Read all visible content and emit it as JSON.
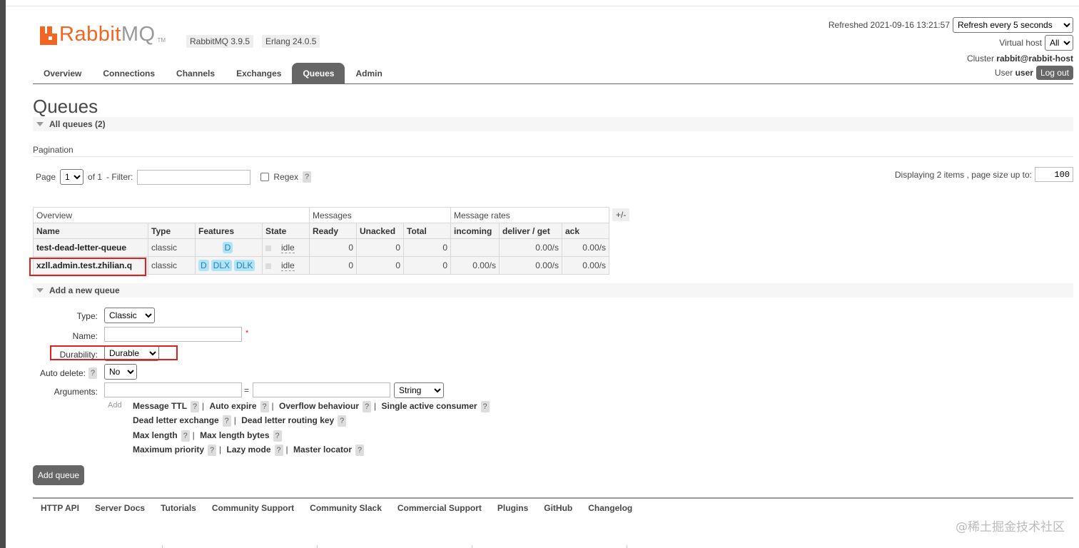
{
  "header": {
    "logo_rabbit": "Rabbit",
    "logo_mq": "MQ",
    "logo_tm": "TM",
    "version_rabbit": "RabbitMQ 3.9.5",
    "version_erlang": "Erlang 24.0.5",
    "refreshed": "Refreshed 2021-09-16 13:21:57",
    "refresh_select": "Refresh every 5 seconds",
    "vhost_label": "Virtual host",
    "vhost_value": "All",
    "cluster_label": "Cluster",
    "cluster_value": "rabbit@rabbit-host",
    "user_label": "User",
    "user_value": "user",
    "logout": "Log out"
  },
  "nav": {
    "tabs": [
      "Overview",
      "Connections",
      "Channels",
      "Exchanges",
      "Queues",
      "Admin"
    ],
    "active": "Queues"
  },
  "page": {
    "title": "Queues",
    "all_queues": "All queues (2)"
  },
  "pagination": {
    "title": "Pagination",
    "page_label": "Page",
    "page_value": "1",
    "of_label": "of 1",
    "filter_label": "- Filter:",
    "filter_value": "",
    "regex_label": "Regex",
    "help": "?",
    "displaying": "Displaying 2 items , page size up to:",
    "page_size": "100"
  },
  "table": {
    "groups": [
      "Overview",
      "Messages",
      "Message rates"
    ],
    "columns": [
      "Name",
      "Type",
      "Features",
      "State",
      "Ready",
      "Unacked",
      "Total",
      "incoming",
      "deliver / get",
      "ack"
    ],
    "plusminus": "+/-",
    "rows": [
      {
        "name": "test-dead-letter-queue",
        "type": "classic",
        "features": [
          "D"
        ],
        "state": "idle",
        "ready": "0",
        "unacked": "0",
        "total": "0",
        "incoming": "",
        "deliver_get": "0.00/s",
        "ack": "0.00/s"
      },
      {
        "name": "xzll.admin.test.zhilian.q",
        "type": "classic",
        "features": [
          "D",
          "DLX",
          "DLK"
        ],
        "state": "idle",
        "ready": "0",
        "unacked": "0",
        "total": "0",
        "incoming": "0.00/s",
        "deliver_get": "0.00/s",
        "ack": "0.00/s"
      }
    ]
  },
  "add_queue": {
    "section": "Add a new queue",
    "type_label": "Type:",
    "type_value": "Classic",
    "name_label": "Name:",
    "name_value": "",
    "required": "*",
    "durability_label": "Durability:",
    "durability_value": "Durable",
    "auto_delete_label": "Auto delete:",
    "auto_delete_help": "?",
    "auto_delete_value": "No",
    "arguments_label": "Arguments:",
    "arg_eq": "=",
    "arg_type": "String",
    "add_label": "Add",
    "arg_rows": [
      [
        "Message TTL",
        "Auto expire",
        "Overflow behaviour",
        "Single active consumer"
      ],
      [
        "Dead letter exchange",
        "Dead letter routing key"
      ],
      [
        "Max length",
        "Max length bytes"
      ],
      [
        "Maximum priority",
        "Lazy mode",
        "Master locator"
      ]
    ],
    "submit": "Add queue"
  },
  "footer": {
    "links": [
      "HTTP API",
      "Server Docs",
      "Tutorials",
      "Community Support",
      "Community Slack",
      "Commercial Support",
      "Plugins",
      "GitHub",
      "Changelog"
    ]
  },
  "watermark": "@稀土掘金技术社区",
  "colors": {
    "brand": "#f26522",
    "tab_active": "#666666",
    "feature_badge": "#aee4f6",
    "highlight_box": "#e02020"
  }
}
